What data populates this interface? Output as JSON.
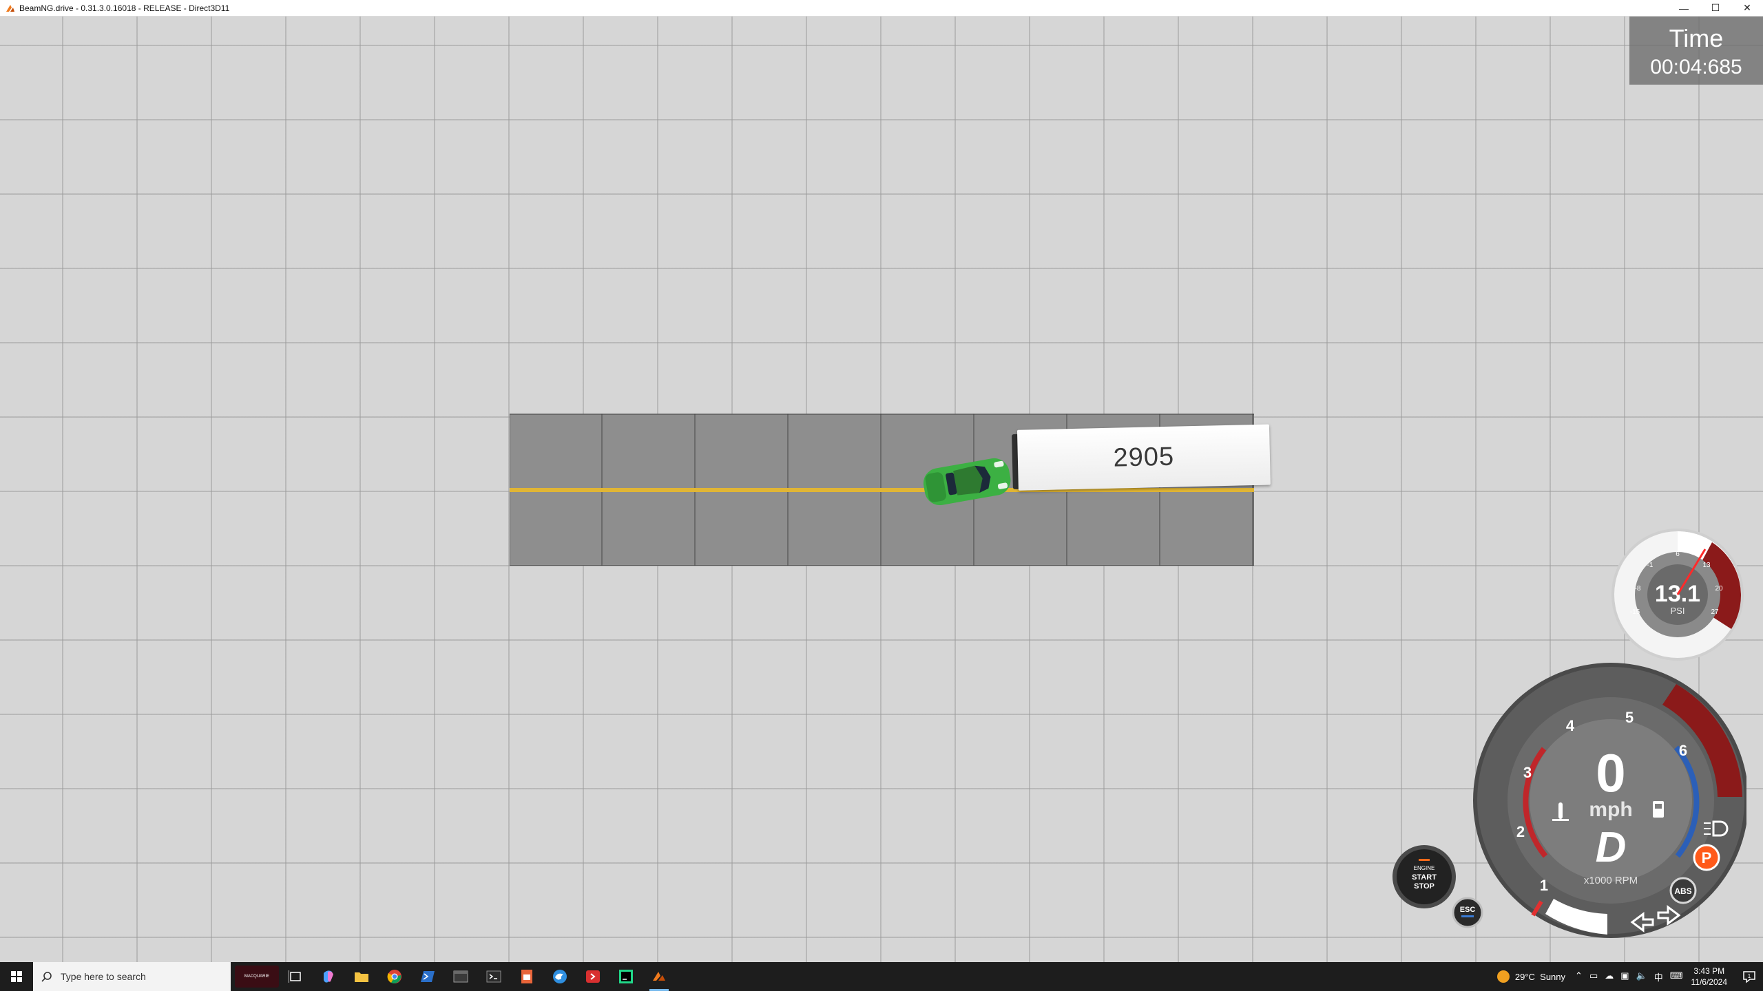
{
  "window": {
    "title": "BeamNG.drive - 0.31.3.0.16018 - RELEASE - Direct3D11",
    "minimize": "—",
    "maximize": "☐",
    "close": "✕"
  },
  "hud": {
    "timer_label": "Time",
    "timer_value": "00:04:685",
    "trailer_number": "2905",
    "boost": {
      "value": "13.1",
      "unit": "PSI",
      "ticks": [
        "-15",
        "-8",
        "-1",
        "6",
        "13",
        "20",
        "27"
      ]
    },
    "speedometer": {
      "speed": "0",
      "unit": "mph",
      "gear": "D",
      "rpm_label": "x1000 RPM",
      "rpm_ticks": [
        "1",
        "2",
        "3",
        "4",
        "5",
        "6"
      ]
    },
    "engine_button": {
      "line1": "ENGINE",
      "line2": "START",
      "line3": "STOP"
    },
    "esc_label": "ESC",
    "abs_label": "ABS",
    "parking_label": "P"
  },
  "taskbar": {
    "search_placeholder": "Type here to search",
    "badge_text": "MACQUARIE",
    "weather_temp": "29°C",
    "weather_desc": "Sunny",
    "tray_lang": "中",
    "time": "3:43 PM",
    "date": "11/6/2024",
    "notification_count": "1"
  },
  "colors": {
    "ground": "#d6d6d6",
    "road": "#8e8e8e",
    "road_line": "#e0b535",
    "car": "#3cb043",
    "redline": "#8b1a1a",
    "rpm_arc": "#2b5fb8",
    "taskbar": "#1d1d1d"
  }
}
